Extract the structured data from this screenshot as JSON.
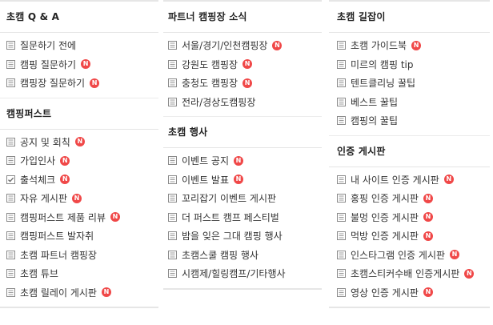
{
  "badge_text": "N",
  "colors": {
    "badge": "#f04848",
    "divider": "#e6e6e6",
    "text": "#333333"
  },
  "columns": [
    {
      "sections": [
        {
          "title": "초캠 Q & A",
          "items": [
            {
              "label": "질문하기 전에",
              "icon": "board-icon",
              "new": false
            },
            {
              "label": "캠핑 질문하기",
              "icon": "board-icon",
              "new": true
            },
            {
              "label": "캠핑장 질문하기",
              "icon": "board-icon",
              "new": true
            }
          ]
        },
        {
          "title": "캠핑퍼스트",
          "items": [
            {
              "label": "공지 및 회칙",
              "icon": "board-icon",
              "new": true
            },
            {
              "label": "가입인사",
              "icon": "board-icon",
              "new": true
            },
            {
              "label": "출석체크",
              "icon": "check-board-icon",
              "new": true
            },
            {
              "label": "자유 게시판",
              "icon": "board-icon",
              "new": true
            },
            {
              "label": "캠핑퍼스트 제품 리뷰",
              "icon": "board-icon",
              "new": true
            },
            {
              "label": "캠핑퍼스트 발자취",
              "icon": "board-icon",
              "new": false
            },
            {
              "label": "초캠 파트너 캠핑장",
              "icon": "board-icon",
              "new": false
            },
            {
              "label": "초캠 튜브",
              "icon": "board-icon",
              "new": false
            },
            {
              "label": "초캠 릴레이 게시판",
              "icon": "board-icon",
              "new": true
            }
          ]
        }
      ]
    },
    {
      "sections": [
        {
          "title": "파트너 캠핑장 소식",
          "items": [
            {
              "label": "서울/경기/인천캠핑장",
              "icon": "board-icon",
              "new": true
            },
            {
              "label": "강원도 캠핑장",
              "icon": "board-icon",
              "new": true
            },
            {
              "label": "충청도 캠핑장",
              "icon": "board-icon",
              "new": true
            },
            {
              "label": "전라/경상도캠핑장",
              "icon": "board-icon",
              "new": false
            }
          ]
        },
        {
          "title": "초캠 행사",
          "items": [
            {
              "label": "이벤트 공지",
              "icon": "board-icon",
              "new": true
            },
            {
              "label": "이벤트 발표",
              "icon": "board-icon",
              "new": true
            },
            {
              "label": "꼬리잡기 이벤트 게시판",
              "icon": "board-icon",
              "new": false
            },
            {
              "label": "더 퍼스트 캠프 페스티벌",
              "icon": "board-icon",
              "new": false
            },
            {
              "label": "밤을 잊은 그대 캠핑 행사",
              "icon": "board-icon",
              "new": false
            },
            {
              "label": "초캠스쿨 캠핑 행사",
              "icon": "board-icon",
              "new": false
            },
            {
              "label": "시캠제/힐링캠프/기타행사",
              "icon": "board-icon",
              "new": false
            }
          ]
        }
      ]
    },
    {
      "sections": [
        {
          "title": "초캠 길잡이",
          "items": [
            {
              "label": "초캠 가이드북",
              "icon": "board-icon",
              "new": true
            },
            {
              "label": "미르의 캠핑 tip",
              "icon": "board-icon",
              "new": false
            },
            {
              "label": "텐트클리닝 꿀팁",
              "icon": "board-icon",
              "new": false
            },
            {
              "label": "베스트 꿀팁",
              "icon": "board-icon",
              "new": false
            },
            {
              "label": "캠핑의 꿀팁",
              "icon": "board-icon",
              "new": false
            }
          ]
        },
        {
          "title": "인증 게시판",
          "items": [
            {
              "label": "내 사이트 인증 게시판",
              "icon": "board-icon",
              "new": true
            },
            {
              "label": "홍핑 인증 게시판",
              "icon": "board-icon",
              "new": true
            },
            {
              "label": "불멍 인증 게시판",
              "icon": "board-icon",
              "new": true
            },
            {
              "label": "먹방 인증 게시판",
              "icon": "board-icon",
              "new": true
            },
            {
              "label": "인스타그램 인증 게시판",
              "icon": "board-icon",
              "new": true
            },
            {
              "label": "초캠스티커수배 인증게시판",
              "icon": "board-icon",
              "new": true
            },
            {
              "label": "영상 인증 게시판",
              "icon": "board-icon",
              "new": true
            }
          ]
        }
      ]
    }
  ]
}
